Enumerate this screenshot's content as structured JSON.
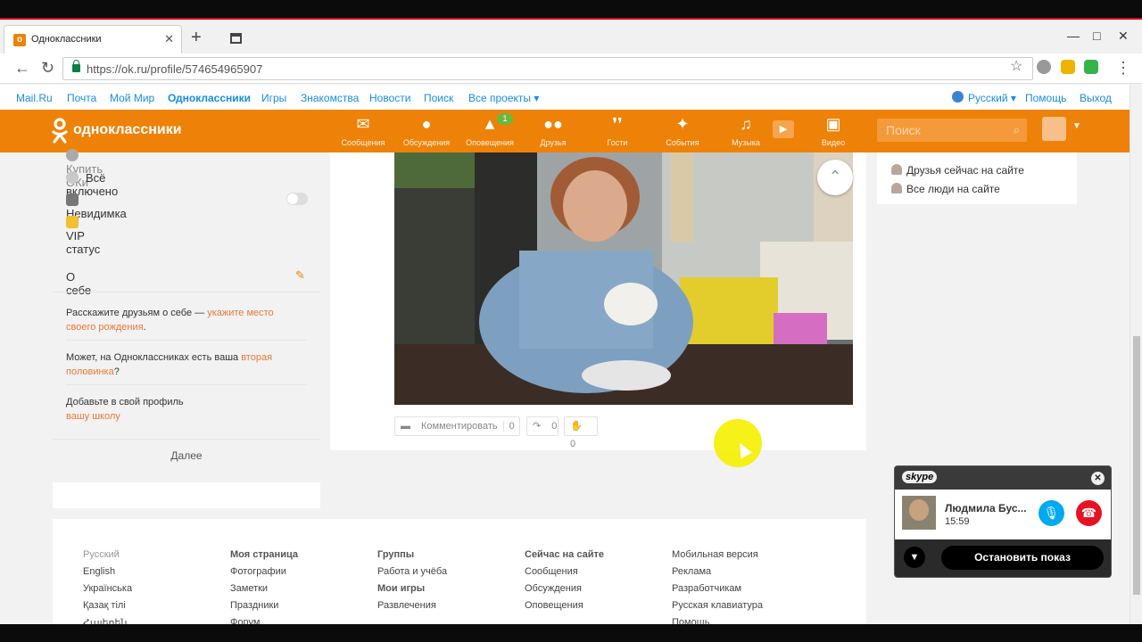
{
  "browser": {
    "tab_title": "Одноклассники",
    "url": "https://ok.ru/profile/574654965907"
  },
  "mailbar": {
    "links": [
      "Mail.Ru",
      "Почта",
      "Мой Мир",
      "Одноклассники",
      "Игры",
      "Знакомства",
      "Новости",
      "Поиск",
      "Все проекты ▾"
    ],
    "language": "Русский ▾",
    "help": "Помощь",
    "logout": "Выход"
  },
  "header": {
    "logo_text": "одноклассники",
    "nav": [
      {
        "label": "Сообщения",
        "icon": "envelope-icon"
      },
      {
        "label": "Обсуждения",
        "icon": "chat-bubbles-icon"
      },
      {
        "label": "Оповещения",
        "icon": "bell-icon",
        "badge": "1"
      },
      {
        "label": "Друзья",
        "icon": "friends-icon"
      },
      {
        "label": "Гости",
        "icon": "footprints-icon"
      },
      {
        "label": "События",
        "icon": "events-icon"
      },
      {
        "label": "Музыка",
        "icon": "music-note-icon"
      },
      {
        "label": "Видео",
        "icon": "video-camera-icon"
      }
    ],
    "search_placeholder": "Поиск"
  },
  "left_menu": {
    "items": [
      "Купить ОКи",
      "Всё включено",
      "Невидимка",
      "VIP статус"
    ],
    "invisible_enabled": false
  },
  "about": {
    "title": "О себе",
    "p1_text": "Расскажите друзьям о себе — ",
    "p1_link": "укажите место своего рождения",
    "p1_end": ".",
    "p2_text": "Может, на Одноклассниках есть ваша ",
    "p2_link": "вторая половинка",
    "p2_end": "?",
    "p3_text": "Добавьте в свой профиль ",
    "p3_link": "вашу школу",
    "more": "Далее"
  },
  "post": {
    "comment_label": "Комментировать",
    "comment_count": "0",
    "share_count": "0",
    "like_count": "0"
  },
  "right": {
    "links": [
      "Друзья сейчас на сайте",
      "Все люди на сайте"
    ]
  },
  "footer": {
    "col1": [
      "Русский",
      "English",
      "Українська",
      "Қазақ тілі",
      "Հայերեն"
    ],
    "col2": [
      "Моя страница",
      "Фотографии",
      "Заметки",
      "Праздники",
      "Форум"
    ],
    "col3a": [
      "Группы",
      "Работа и учёба"
    ],
    "col3b": [
      "Мои игры",
      "Развлечения"
    ],
    "col4": [
      "Сейчас на сайте",
      "Сообщения",
      "Обсуждения",
      "Оповещения"
    ],
    "col5": [
      "Мобильная версия",
      "Реклама",
      "Разработчикам",
      "Русская клавиатура",
      "Помощь"
    ]
  },
  "skype": {
    "logo": "skype",
    "caller_name": "Людмила Бус...",
    "call_time": "15:59",
    "stop_label": "Остановить показ"
  },
  "colors": {
    "ok_orange": "#ee8208",
    "link_blue": "#168de2",
    "link_orange": "#e8793a",
    "skype_blue": "#00a9f0",
    "hangup_red": "#e81123"
  }
}
